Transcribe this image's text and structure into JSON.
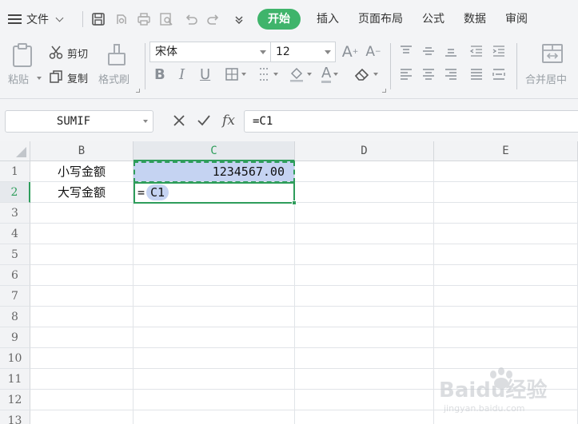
{
  "menu": {
    "file_label": "文件",
    "tabs": [
      "开始",
      "插入",
      "页面布局",
      "公式",
      "数据",
      "审阅"
    ],
    "active_tab": "开始"
  },
  "ribbon": {
    "paste": "粘贴",
    "cut": "剪切",
    "copy": "复制",
    "format_painter": "格式刷",
    "font_name": "宋体",
    "font_size": "12",
    "merge": "合并居中"
  },
  "formula_bar": {
    "name_box": "SUMIF",
    "fx": "fx",
    "formula": "=C1"
  },
  "sheet": {
    "columns": [
      "B",
      "C",
      "D",
      "E"
    ],
    "rows": [
      "1",
      "2",
      "3",
      "4",
      "5",
      "6",
      "7",
      "8",
      "9",
      "10",
      "11",
      "12",
      "13"
    ],
    "b1": "小写金额",
    "c1": "1234567.00",
    "b2": "大写金额",
    "c2_eq": "=",
    "c2_ref": "C1"
  },
  "colors": {
    "accent_green": "#3fb46b",
    "selection_blue": "#c5d3f2",
    "active_border": "#2e9d5b"
  },
  "watermark": {
    "text": "Baidu经验",
    "url": "jingyan.baidu.com"
  }
}
